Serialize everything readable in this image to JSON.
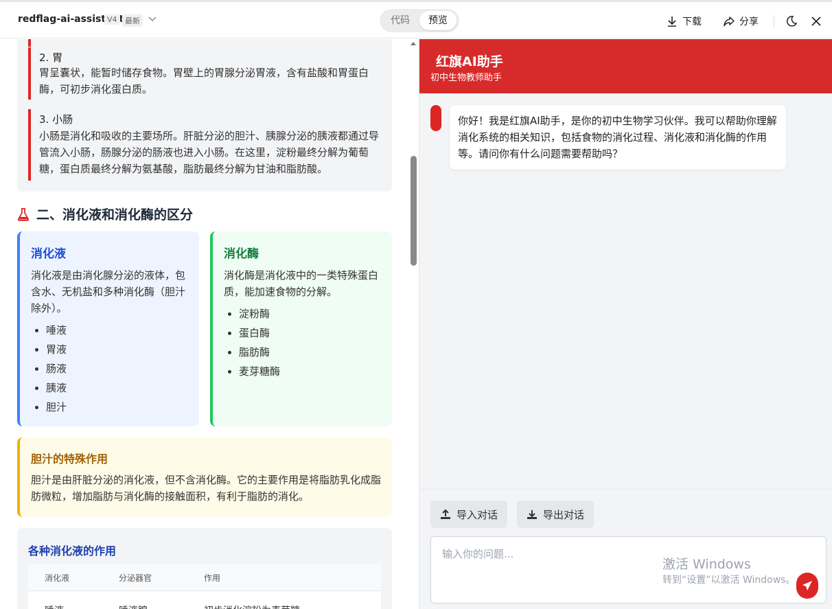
{
  "header": {
    "app_name": "redflag-ai-assistant",
    "version": "V4",
    "latest": "最新",
    "tab_code": "代码",
    "tab_preview": "预览",
    "download": "下载",
    "share": "分享"
  },
  "lesson": {
    "steps": [
      {
        "title": "2. 胃",
        "body": "胃呈囊状，能暂时储存食物。胃壁上的胃腺分泌胃液，含有盐酸和胃蛋白酶，可初步消化蛋白质。"
      },
      {
        "title": "3. 小肠",
        "body": "小肠是消化和吸收的主要场所。肝脏分泌的胆汁、胰腺分泌的胰液都通过导管流入小肠，肠腺分泌的肠液也进入小肠。在这里，淀粉最终分解为葡萄糖，蛋白质最终分解为氨基酸，脂肪最终分解为甘油和脂肪酸。"
      }
    ],
    "section2_title": "二、消化液和消化酶的区分",
    "juice": {
      "title": "消化液",
      "desc": "消化液是由消化腺分泌的液体，包含水、无机盐和多种消化酶（胆汁除外）。",
      "items": [
        "唾液",
        "胃液",
        "肠液",
        "胰液",
        "胆汁"
      ]
    },
    "enzyme": {
      "title": "消化酶",
      "desc": "消化酶是消化液中的一类特殊蛋白质，能加速食物的分解。",
      "items": [
        "淀粉酶",
        "蛋白酶",
        "脂肪酶",
        "麦芽糖酶"
      ]
    },
    "bile": {
      "title": "胆汁的特殊作用",
      "body": "胆汁是由肝脏分泌的消化液，但不含消化酶。它的主要作用是将脂肪乳化成脂肪微粒，增加脂肪与消化酶的接触面积，有利于脂肪的消化。"
    },
    "table": {
      "title": "各种消化液的作用",
      "headers": [
        "消化液",
        "分泌器官",
        "作用"
      ],
      "row1": [
        "唾液",
        "唾液腺",
        "初步消化淀粉为麦芽糖"
      ]
    }
  },
  "chat": {
    "title": "红旗AI助手",
    "subtitle": "初中生物教师助手",
    "greeting": "你好！我是红旗AI助手，是你的初中生物学习伙伴。我可以帮助你理解消化系统的相关知识，包括食物的消化过程、消化液和消化酶的作用等。请问你有什么问题需要帮助吗？",
    "import_label": "导入对话",
    "export_label": "导出对话",
    "input_placeholder": "输入你的问题..."
  },
  "watermark": {
    "title": "激活 Windows",
    "subtitle": "转到“设置”以激活 Windows。"
  },
  "colors": {
    "brand_red": "#d72b2b",
    "juice_accent": "#3b82f6",
    "enzyme_accent": "#22c55e",
    "bile_accent": "#eab308"
  }
}
